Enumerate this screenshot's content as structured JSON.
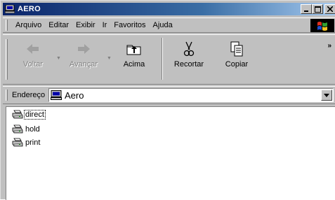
{
  "window": {
    "title": "AERO"
  },
  "menubar": {
    "items": [
      {
        "label": "Arquivo"
      },
      {
        "label": "Editar"
      },
      {
        "label": "Exibir"
      },
      {
        "label": "Ir"
      },
      {
        "label": "Favoritos"
      },
      {
        "label": "Ajuda"
      }
    ]
  },
  "toolbar": {
    "back_label": "Voltar",
    "forward_label": "Avançar",
    "up_label": "Acima",
    "cut_label": "Recortar",
    "copy_label": "Copiar",
    "overflow": "»"
  },
  "address": {
    "label": "Endereço",
    "value": "Aero"
  },
  "files": [
    {
      "name": "direct",
      "icon": "printer-icon",
      "focused": true
    },
    {
      "name": "hold",
      "icon": "printer-icon",
      "focused": false
    },
    {
      "name": "print",
      "icon": "printer-icon",
      "focused": false
    }
  ],
  "colors": {
    "titlebar_start": "#0a246a",
    "titlebar_end": "#a6caf0",
    "face": "#c0c0c0"
  }
}
